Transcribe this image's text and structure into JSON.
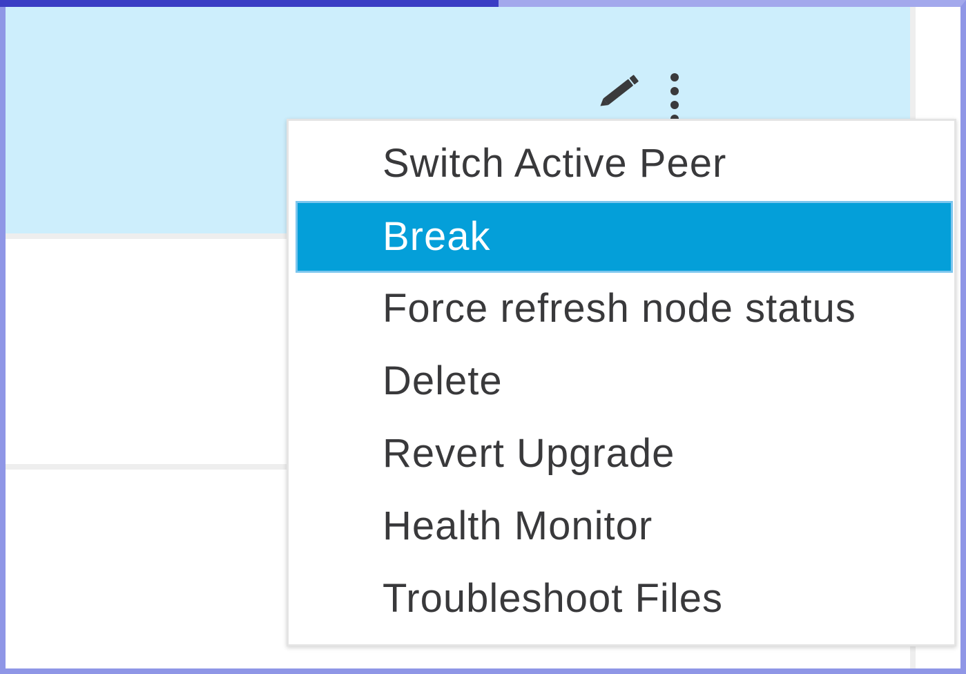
{
  "menu": {
    "items": [
      {
        "label": "Switch Active Peer",
        "active": false
      },
      {
        "label": "Break",
        "active": true
      },
      {
        "label": "Force refresh node status",
        "active": false
      },
      {
        "label": "Delete",
        "active": false
      },
      {
        "label": "Revert Upgrade",
        "active": false
      },
      {
        "label": "Health Monitor",
        "active": false
      },
      {
        "label": "Troubleshoot Files",
        "active": false
      }
    ]
  },
  "icons": {
    "edit": "pencil-icon",
    "more": "more-vertical-icon"
  },
  "colors": {
    "selected_row_bg": "#cdeefc",
    "menu_highlight": "#049fd9",
    "menu_text": "#39393b",
    "frame_border": "#8f96e6"
  }
}
